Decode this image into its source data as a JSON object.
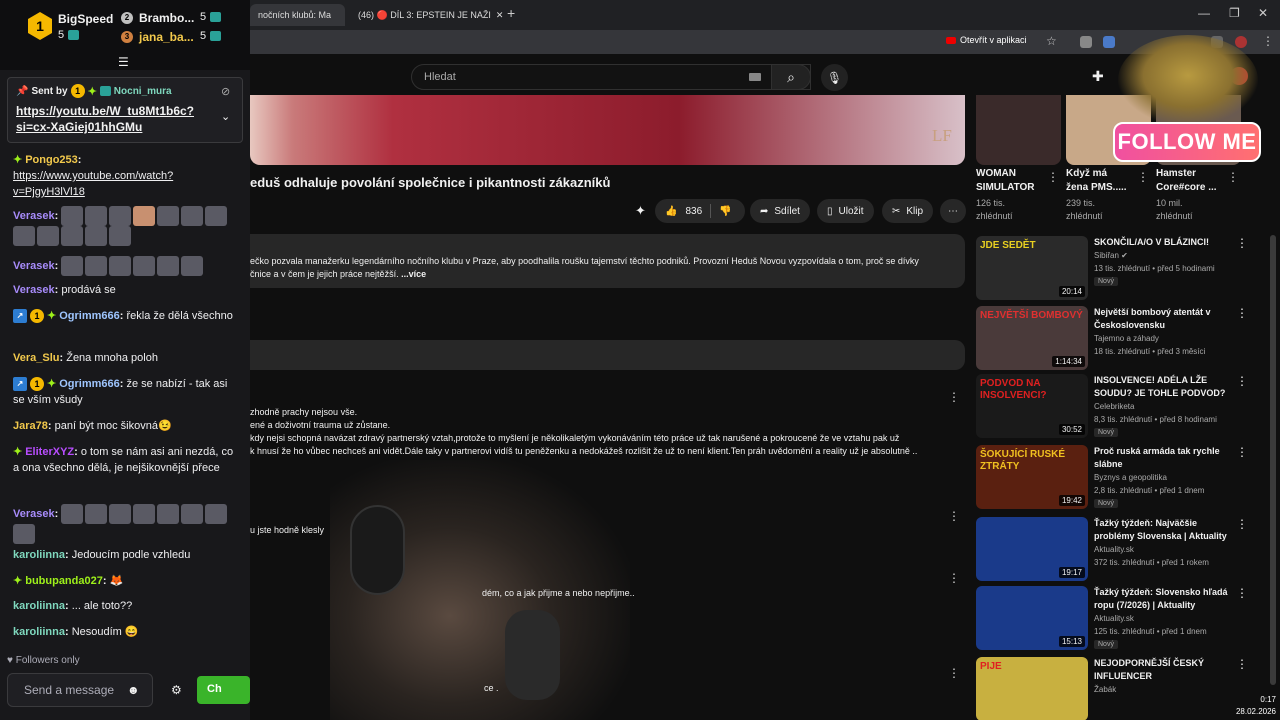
{
  "browser": {
    "tabs": [
      {
        "label": "nočních klubů: Ma"
      },
      {
        "label": "(46) 🔴 DÍL 3: EPSTEIN JE NAŽI"
      }
    ],
    "open_app_label": "Otevřít v aplikaci"
  },
  "youtube": {
    "search_placeholder": "Hledat",
    "notification_count": "9+",
    "video": {
      "watermark": "LF",
      "title": "eduš odhaluje povolání společnice i pikantnosti zákazníků",
      "likes": "836",
      "share_label": "Sdílet",
      "save_label": "Uložit",
      "clip_label": "Klip",
      "description_line1": "ečko pozvala manažerku legendárního nočního klubu v Praze, aby poodhalila roušku tajemství těchto podniků. Provozní Heduš Novou vyzpovídala o tom, proč se dívky",
      "description_line2": "čnice a v čem je jejich práce nejtěžší.",
      "description_more": "...více"
    },
    "comments": [
      {
        "lines": [
          "zhodně prachy nejsou vše.",
          "ené a doživotní trauma už zůstane.",
          " kdy nejsi schopná navázat zdravý partnerský vztah,protože to myšlení je několikaletým vykonáváním této práce už tak narušené a pokroucené že ve vztahu pak už",
          "k hnusí že ho vůbec nechceš ani vidět.Dále taky v partnerovi vidíš tu peněženku a nedokážeš rozlišit že už to není klient.Ten práh uvědomění a reality už je absolutně .."
        ]
      },
      {
        "lines": [
          "u jste hodně klesly"
        ]
      },
      {
        "lines": [
          "dém, co a jak přijme a nebo nepřijme.."
        ]
      },
      {
        "lines": [
          "ce ."
        ]
      }
    ],
    "shorts": [
      {
        "title": [
          "WOMAN",
          "SIMULATOR"
        ],
        "views": [
          "126 tis.",
          "zhlédnutí"
        ],
        "color": "#3a2a2a"
      },
      {
        "title": [
          "Když má",
          "žena PMS....."
        ],
        "views": [
          "239 tis.",
          "zhlédnutí"
        ],
        "color": "#c8a888"
      },
      {
        "title": [
          "Hamster",
          "Core#core ..."
        ],
        "views": [
          "10 mil.",
          "zhlédnutí"
        ],
        "color": "#6a5a50"
      }
    ],
    "sidebar": [
      {
        "title": "SKONČIL/A/O V BLÁZINCI!",
        "channel": "Sibiřan ✔",
        "meta": "13 tis. zhlédnutí • před 5 hodinami",
        "duration": "20:14",
        "new": "Nový",
        "thumb_text": "JDE SEDĚT",
        "color": "#2a2a2a",
        "accent": "#e8d020"
      },
      {
        "title": "Největší bombový atentát v Československu",
        "channel": "Tajemno a záhady",
        "meta": "18 tis. zhlédnutí • před 3 měsíci",
        "duration": "1:14:34",
        "new": "",
        "thumb_text": "NEJVĚTŠÍ BOMBOVÝ",
        "color": "#4a3a3a",
        "accent": "#e03030"
      },
      {
        "title": "INSOLVENCE! ADÉLA LŽE SOUDU? JE TOHLE PODVOD?",
        "channel": "Celebriketa",
        "meta": "8,3 tis. zhlédnutí • před 8 hodinami",
        "duration": "30:52",
        "new": "Nový",
        "thumb_text": "PODVOD NA INSOLVENCI?",
        "color": "#1a1a1a",
        "accent": "#e02020"
      },
      {
        "title": "Proč ruská armáda tak rychle slábne",
        "channel": "Byznys a geopolitika",
        "meta": "2,8 tis. zhlédnutí • před 1 dnem",
        "duration": "19:42",
        "new": "Nový",
        "thumb_text": "ŠOKUJÍCÍ RUSKÉ ZTRÁTY",
        "color": "#5a2010",
        "accent": "#f0c020"
      },
      {
        "title": "Ťažký týždeň: Najväčšie problémy Slovenska | Aktuality",
        "channel": "Aktuality.sk",
        "meta": "372 tis. zhlédnutí • před 1 rokem",
        "duration": "19:17",
        "new": "",
        "thumb_text": "",
        "color": "#1a3a8a",
        "accent": "#ffffff"
      },
      {
        "title": "Ťažký týždeň: Slovensko hľadá ropu (7/2026) | Aktuality",
        "channel": "Aktuality.sk",
        "meta": "125 tis. zhlédnutí • před 1 dnem",
        "duration": "15:13",
        "new": "Nový",
        "thumb_text": "",
        "color": "#1a3a8a",
        "accent": "#ffffff"
      },
      {
        "title": "NEJODPORNĚJŠÍ ČESKÝ INFLUENCER",
        "channel": "Žabák",
        "meta": "",
        "duration": "",
        "new": "",
        "thumb_text": "PIJE",
        "color": "#c8b040",
        "accent": "#e02020"
      }
    ]
  },
  "overlay": {
    "follow_label": "FOLLOW ME"
  },
  "clock": {
    "time": "0:17",
    "date": "28.02.2026"
  },
  "chat": {
    "leaderboard": [
      {
        "rank": "1",
        "name": "BigSpeed",
        "count": "5"
      },
      {
        "rank": "2",
        "name": "Brambo...",
        "count": "5"
      },
      {
        "rank": "3",
        "name": "jana_ba...",
        "count": "5"
      }
    ],
    "pinned": {
      "sent_by": "Sent by",
      "user": "Nocni_mura",
      "link": "https://youtu.be/W_tu8Mt1b6c?si=cx-XaGiej01hhGMu",
      "link_line1": "https://youtu.be/W_tu8Mt1b6c?",
      "link_line2": "si=cx-XaGiej01hhGMu"
    },
    "messages": [
      {
        "user": "Pongo253",
        "color": "#f2c94c",
        "text": "",
        "link": [
          "https://www.youtube.com/watch?",
          "v=PjgyH3lVl18"
        ]
      },
      {
        "user": "Verasek",
        "color": "#a78bfa",
        "text": "",
        "emotes": 12
      },
      {
        "user": "Verasek",
        "color": "#a78bfa",
        "text": "",
        "emotes": 6
      },
      {
        "user": "Verasek",
        "color": "#a78bfa",
        "text": "prodává se"
      },
      {
        "user": "Ogrimm666",
        "color": "#9ec5fe",
        "text": "řekla že dělá všechno"
      },
      {
        "user": "Vera_Slu",
        "color": "#f2c94c",
        "text": "Žena mnoha poloh"
      },
      {
        "user": "Ogrimm666",
        "color": "#9ec5fe",
        "text": "že se nabízí - tak asi se vším všudy"
      },
      {
        "user": "Jara78",
        "color": "#f2c94c",
        "text": "paní být moc šikovná😉"
      },
      {
        "user": "EliterXYZ",
        "color": "#b84dff",
        "text": "o tom se nám asi ani nezdá, co a ona všechno dělá, je nejšikovnější přece"
      },
      {
        "user": "Verasek",
        "color": "#a78bfa",
        "text": "",
        "emotes": 8
      },
      {
        "user": "karoliinna",
        "color": "#7fd8be",
        "text": "Jedoucím podle vzhledu"
      },
      {
        "user": "bubupanda027",
        "color": "#9ef01a",
        "text": "🦊"
      },
      {
        "user": "karoliinna",
        "color": "#7fd8be",
        "text": "... ale toto??"
      },
      {
        "user": "karoliinna",
        "color": "#7fd8be",
        "text": "Nesoudím 😄"
      }
    ],
    "followers_only": "Followers only",
    "send_placeholder": "Send a message",
    "chat_button": "Ch"
  }
}
